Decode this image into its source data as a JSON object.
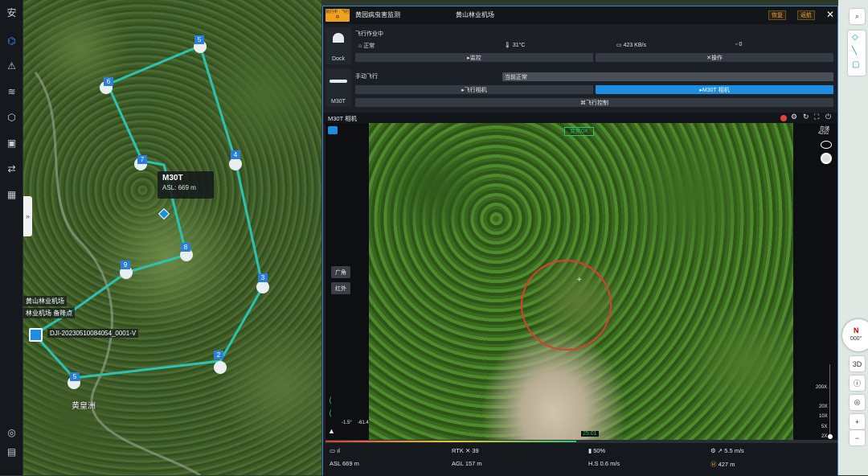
{
  "sidebar": {
    "items": [
      {
        "name": "security",
        "glyph": "安"
      },
      {
        "name": "drone",
        "glyph": "⌬"
      },
      {
        "name": "warning",
        "glyph": "⚠"
      },
      {
        "name": "layers",
        "glyph": "≋"
      },
      {
        "name": "cube",
        "glyph": "⬡"
      },
      {
        "name": "media",
        "glyph": "▣"
      },
      {
        "name": "flight-route",
        "glyph": "⇄"
      },
      {
        "name": "calendar",
        "glyph": "▦"
      }
    ],
    "bottom": [
      {
        "name": "globe",
        "glyph": "◎"
      },
      {
        "name": "document",
        "glyph": "▤"
      }
    ],
    "expand_glyph": "»"
  },
  "map": {
    "tooltip": {
      "title": "M30T",
      "subtitle": "ASL: 669 m"
    },
    "waypoints": [
      "1",
      "2",
      "3",
      "4",
      "5",
      "6",
      "7",
      "8",
      "9",
      "5"
    ],
    "labels": {
      "dock_name": "黄山林业机场",
      "dock_standby": "林业机场 备降点",
      "device_sn": "DJI-20230510084054_0001-V",
      "place": "黄皇洲"
    }
  },
  "panel": {
    "header": {
      "badge": "执行中 · 飞行中",
      "task_name": "黄园病虫害监测",
      "dock_name": "黄山林业机场",
      "restore_label": "恢复",
      "return_label": "返航",
      "close_glyph": "✕"
    },
    "dock": {
      "label": "Dock",
      "status": "飞行作业中",
      "state": "正常",
      "temperature": "31°C",
      "network": "423 KB/s",
      "count": "0",
      "monitor_label": "监控",
      "operate_label": "操作"
    },
    "drone": {
      "label": "M30T",
      "status": "手动飞行",
      "current_state": "当前正常",
      "fly_camera_label": "飞行相机",
      "m30t_camera_label": "M30T 相机",
      "flight_control_label": "飞行控制"
    },
    "camera": {
      "title": "M30T 相机",
      "hud_label": "变焦0X",
      "storage_label": "存储",
      "storage_value": "4292",
      "wide_label": "广角",
      "ir_label": "红外",
      "zoom_levels": [
        "200X",
        "20X",
        "10X",
        "5X",
        "2X"
      ],
      "gimbal_pitch": "-1.5°",
      "gimbal_yaw": "-61.4°",
      "flight_time": "25:01",
      "progress_fraction": 0.49
    },
    "telemetry": {
      "asl": "ASL 669 m",
      "rtk": "RTK",
      "rtk_count": "39",
      "agl": "AGL 157 m",
      "battery": "50%",
      "hs": "H.S 0.6 m/s",
      "vs": "5.5 m/s",
      "distance": "427 m"
    }
  },
  "right_map": {
    "zoom_in": "+",
    "zoom_out": "−",
    "mode_3d": "3D",
    "compass": "N",
    "compass_deg": "000°"
  },
  "colors": {
    "route": "#2bc3b0",
    "accent": "#1d8de0",
    "status_green": "#35c26f",
    "warning": "#e8a23a"
  }
}
